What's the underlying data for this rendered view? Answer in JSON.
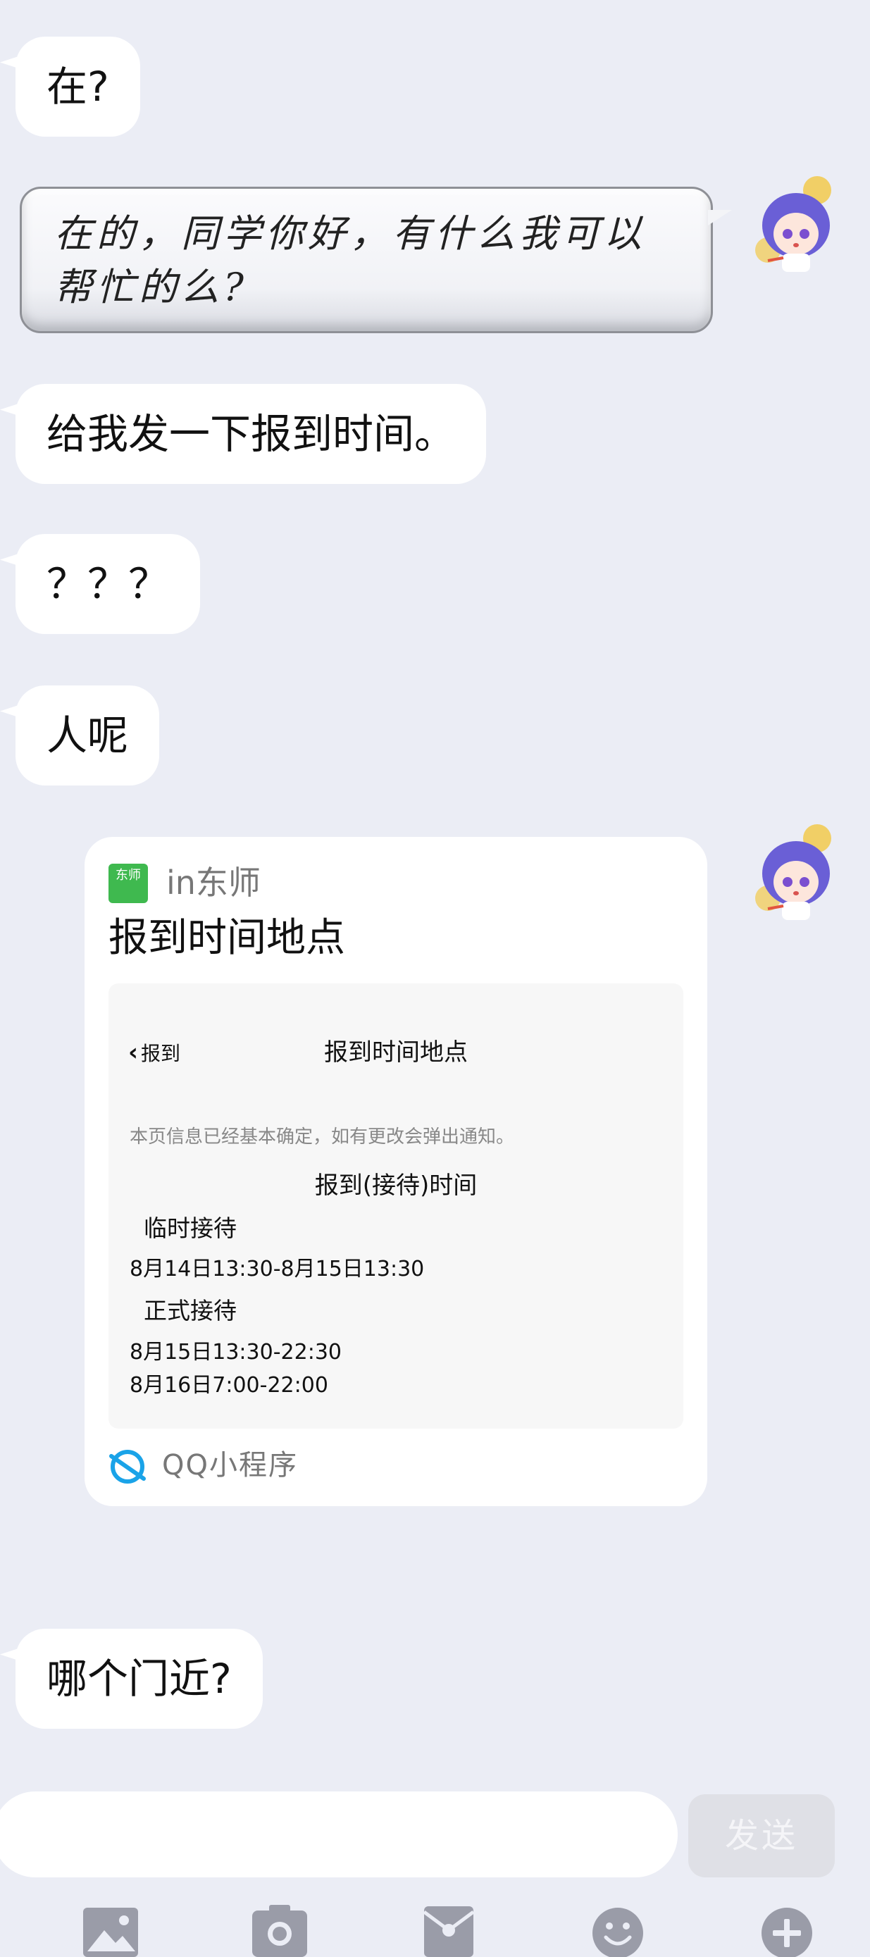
{
  "messages": {
    "m1": "在?",
    "reply": "在的，同学你好，有什么我可以帮忙的么?",
    "m2": "给我发一下报到时间。",
    "m3": "？？？",
    "m4": "人呢",
    "m5": "哪个门近?"
  },
  "card": {
    "app_icon_text": "东师",
    "app_name": "in东师",
    "title": "报到时间地点",
    "preview": {
      "back_label": "报到",
      "header": "报到时间地点",
      "note": "本页信息已经基本确定，如有更改会弹出通知。",
      "section_title": "报到(接待)时间",
      "temp_label": "临时接待",
      "temp_time": "8月14日13:30-8月15日13:30",
      "formal_label": "正式接待",
      "formal_time_1": "8月15日13:30-22:30",
      "formal_time_2": "8月16日7:00-22:00"
    },
    "footer": "QQ小程序"
  },
  "input": {
    "send_label": "发送"
  },
  "toolbar": [
    "image-icon",
    "camera-icon",
    "red-packet-icon",
    "emoji-icon",
    "plus-icon"
  ],
  "colors": {
    "background": "#ebedf5",
    "bubble": "#ffffff",
    "app_green": "#3fb94f",
    "miniapp_blue": "#1aa3e8",
    "toolbar_gray": "#9a9ca8"
  }
}
